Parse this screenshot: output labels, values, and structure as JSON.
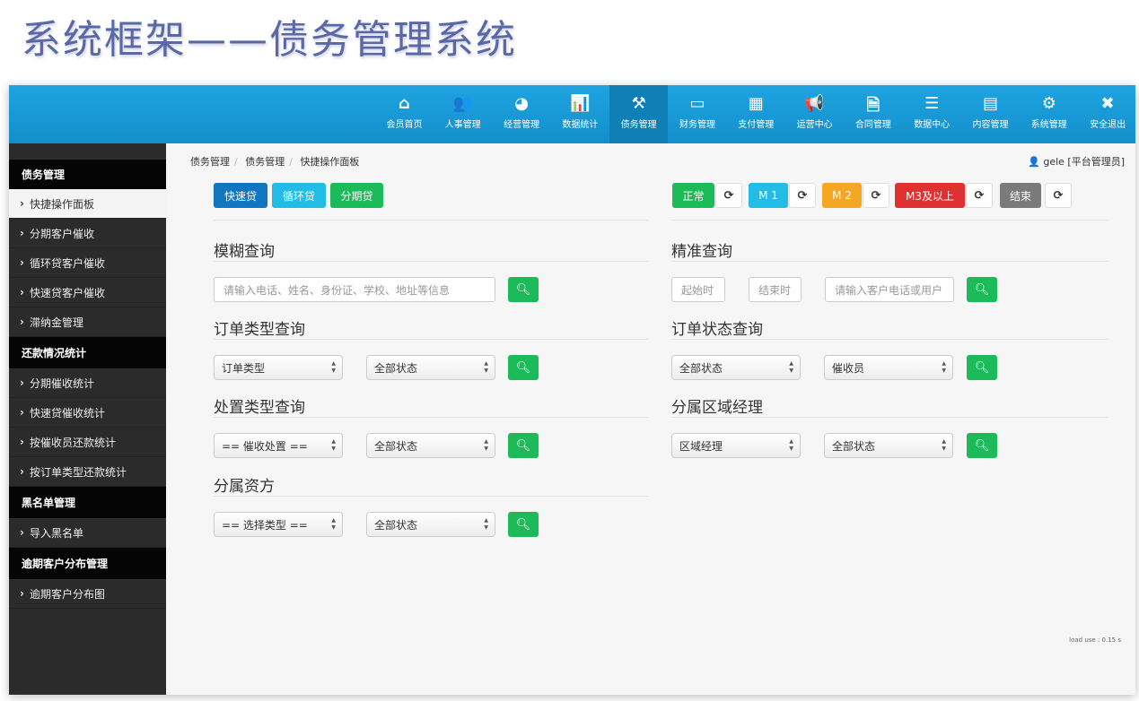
{
  "slide_title": "系统框架——债务管理系统",
  "nav": [
    {
      "label": "会员首页",
      "icon": "home-icon",
      "glyph": "⌂"
    },
    {
      "label": "人事管理",
      "icon": "users-icon",
      "glyph": "👥"
    },
    {
      "label": "经营管理",
      "icon": "pie-chart-icon",
      "glyph": "◕"
    },
    {
      "label": "数据统计",
      "icon": "bar-chart-icon",
      "glyph": "📊"
    },
    {
      "label": "债务管理",
      "icon": "gavel-icon",
      "glyph": "⚒"
    },
    {
      "label": "财务管理",
      "icon": "credit-card-icon",
      "glyph": "▭"
    },
    {
      "label": "支付管理",
      "icon": "calculator-icon",
      "glyph": "▦"
    },
    {
      "label": "运营中心",
      "icon": "bullhorn-icon",
      "glyph": "📢"
    },
    {
      "label": "合同管理",
      "icon": "pdf-file-icon",
      "glyph": "🗎"
    },
    {
      "label": "数据中心",
      "icon": "server-icon",
      "glyph": "☰"
    },
    {
      "label": "内容管理",
      "icon": "newspaper-icon",
      "glyph": "▤"
    },
    {
      "label": "系统管理",
      "icon": "gears-icon",
      "glyph": "⚙"
    },
    {
      "label": "安全退出",
      "icon": "close-icon",
      "glyph": "✖"
    }
  ],
  "sidebar": {
    "sections": [
      {
        "title": "债务管理",
        "items": [
          "快捷操作面板",
          "分期客户催收",
          "循环贷客户催收",
          "快速贷客户催收",
          "滞纳金管理"
        ]
      },
      {
        "title": "还款情况统计",
        "items": [
          "分期催收统计",
          "快速贷催收统计",
          "按催收员还款统计",
          "按订单类型还款统计"
        ]
      },
      {
        "title": "黑名单管理",
        "items": [
          "导入黑名单"
        ]
      },
      {
        "title": "逾期客户分布管理",
        "items": [
          "逾期客户分布图"
        ]
      }
    ]
  },
  "breadcrumb": [
    "债务管理",
    "债务管理",
    "快捷操作面板"
  ],
  "user": "gele [平台管理员]",
  "loan_buttons": [
    "快速贷",
    "循环贷",
    "分期贷"
  ],
  "status_buttons": [
    "正常",
    "M 1",
    "M 2",
    "M3及以上",
    "结束"
  ],
  "colors": {
    "nav": "#1a9bd7",
    "green": "#1bbb5a",
    "cyan": "#22bde6",
    "orange": "#f5a623",
    "red": "#e03131",
    "gray": "#7a7a7a",
    "blue": "#1275c0"
  },
  "fuzzy": {
    "title": "模糊查询",
    "placeholder": "请输入电话、姓名、身份证、学校、地址等信息"
  },
  "exact": {
    "title": "精准查询",
    "start": "起始时",
    "end": "结束时",
    "customer": "请输入客户电话或用户"
  },
  "order_type": {
    "title": "订单类型查询",
    "sel1": "订单类型",
    "sel2": "全部状态"
  },
  "order_status": {
    "title": "订单状态查询",
    "sel1": "全部状态",
    "sel2": "催收员"
  },
  "disposal": {
    "title": "处置类型查询",
    "sel1": "== 催收处置 ==",
    "sel2": "全部状态"
  },
  "region": {
    "title": "分属区域经理",
    "sel1": "区域经理",
    "sel2": "全部状态"
  },
  "funder": {
    "title": "分属资方",
    "sel1": "== 选择类型 ==",
    "sel2": "全部状态"
  },
  "load_use": "load use : 0.15 s"
}
